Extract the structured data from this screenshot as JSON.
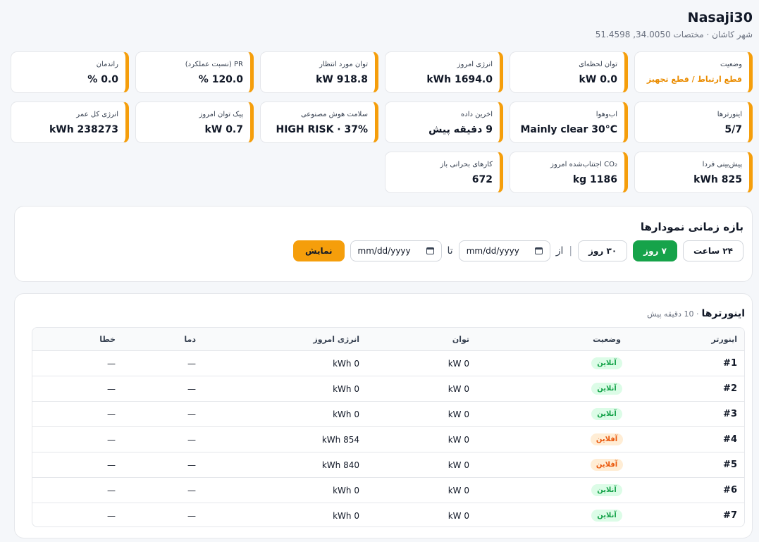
{
  "site": {
    "title": "Nasaji30",
    "subtitle": "شهر کاشان · مختصات 34.0050, 51.4598"
  },
  "kpis": [
    {
      "label": "وضعیت",
      "value": "قطع ارتباط / قطع تجهیز",
      "warn": true
    },
    {
      "label": "توان لحظه‌ای",
      "value": "0.0 kW"
    },
    {
      "label": "انرژی امروز",
      "value": "1694.0 kWh"
    },
    {
      "label": "توان مورد انتظار",
      "value": "918.8 kW"
    },
    {
      "label": "PR (نسبت عملکرد)",
      "value": "120.0 %"
    },
    {
      "label": "راندمان",
      "value": "0.0 %"
    },
    {
      "label": "اینورترها",
      "value": "5/7"
    },
    {
      "label": "آب‌وهوا",
      "value": "Mainly clear 30°C"
    },
    {
      "label": "آخرین داده",
      "value": "9 دقیقه پیش"
    },
    {
      "label": "سلامت هوش مصنوعی",
      "value": "HIGH RISK · 37%"
    },
    {
      "label": "پیک توان امروز",
      "value": "0.7 kW"
    },
    {
      "label": "انرژی کل عمر",
      "value": "238273 kWh"
    },
    {
      "label": "پیش‌بینی فردا",
      "value": "825 kWh"
    },
    {
      "label": "CO₂ اجتناب‌شده امروز",
      "value": "1186 kg"
    },
    {
      "label": "کارهای بحرانی باز",
      "value": "672"
    }
  ],
  "range": {
    "title": "بازه زمانی نمودارها",
    "btn_24h": "۲۴ ساعت",
    "btn_7d": "۷ روز",
    "btn_30d": "۳۰ روز",
    "sep": "|",
    "from": "از",
    "to": "تا",
    "date_placeholder": "mm/dd/yyyy",
    "show": "نمایش"
  },
  "inverters": {
    "title": "اینورترها",
    "meta": "· 10 دقیقه پیش",
    "headers": {
      "inverter": "اینورتر",
      "status": "وضعیت",
      "power": "توان",
      "energy": "انرژی امروز",
      "temp": "دما",
      "error": "خطا"
    },
    "rows": [
      {
        "id": "#1",
        "status": "آنلاین",
        "online": true,
        "power": "0 kW",
        "energy": "0 kWh",
        "temp": "—",
        "error": "—"
      },
      {
        "id": "#2",
        "status": "آنلاین",
        "online": true,
        "power": "0 kW",
        "energy": "0 kWh",
        "temp": "—",
        "error": "—"
      },
      {
        "id": "#3",
        "status": "آنلاین",
        "online": true,
        "power": "0 kW",
        "energy": "0 kWh",
        "temp": "—",
        "error": "—"
      },
      {
        "id": "#4",
        "status": "آفلاین",
        "online": false,
        "power": "0 kW",
        "energy": "854 kWh",
        "temp": "—",
        "error": "—"
      },
      {
        "id": "#5",
        "status": "آفلاین",
        "online": false,
        "power": "0 kW",
        "energy": "840 kWh",
        "temp": "—",
        "error": "—"
      },
      {
        "id": "#6",
        "status": "آنلاین",
        "online": true,
        "power": "0 kW",
        "energy": "0 kWh",
        "temp": "—",
        "error": "—"
      },
      {
        "id": "#7",
        "status": "آنلاین",
        "online": true,
        "power": "0 kW",
        "energy": "0 kWh",
        "temp": "—",
        "error": "—"
      }
    ]
  }
}
